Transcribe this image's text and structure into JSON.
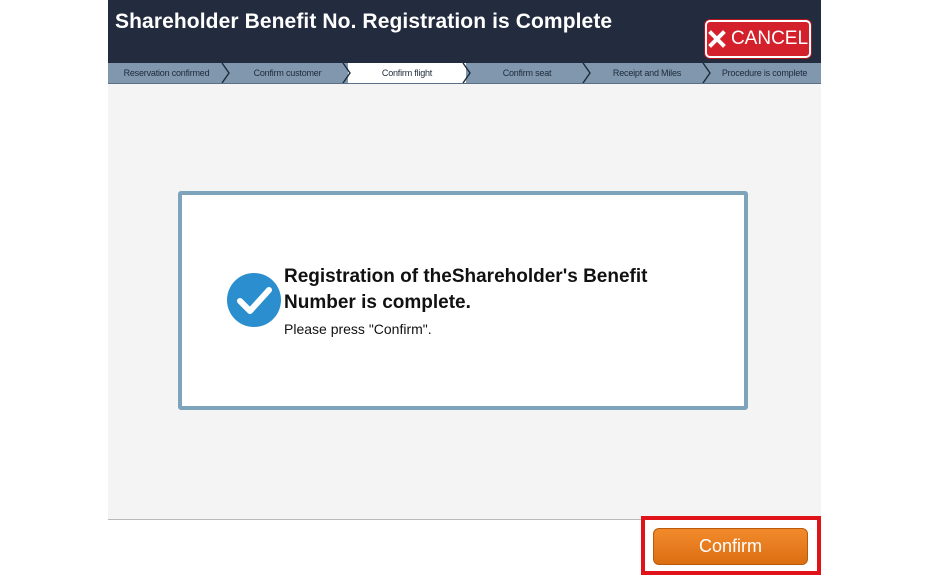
{
  "header": {
    "title": "Shareholder Benefit No. Registration is Complete",
    "cancel_label": "CANCEL"
  },
  "steps": [
    {
      "label": "Reservation confirmed",
      "active": false
    },
    {
      "label": "Confirm customer",
      "active": false
    },
    {
      "label": "Confirm flight",
      "active": true
    },
    {
      "label": "Confirm seat",
      "active": false
    },
    {
      "label": "Receipt and Miles",
      "active": false
    },
    {
      "label": "Procedure is complete",
      "active": false
    }
  ],
  "dialog": {
    "message": "Registration of theShareholder's Benefit Number is complete.",
    "instruction": "Please press \"Confirm\"."
  },
  "footer": {
    "confirm_label": "Confirm"
  },
  "colors": {
    "header_bg": "#232b3f",
    "steps_bg": "#8197ae",
    "cancel_red": "#d3202a",
    "check_blue": "#2b8fcf",
    "confirm_orange": "#e97d1f",
    "highlight_red": "#e0121a"
  },
  "icons": {
    "cancel": "close-icon",
    "status": "checkmark-circle-icon"
  }
}
